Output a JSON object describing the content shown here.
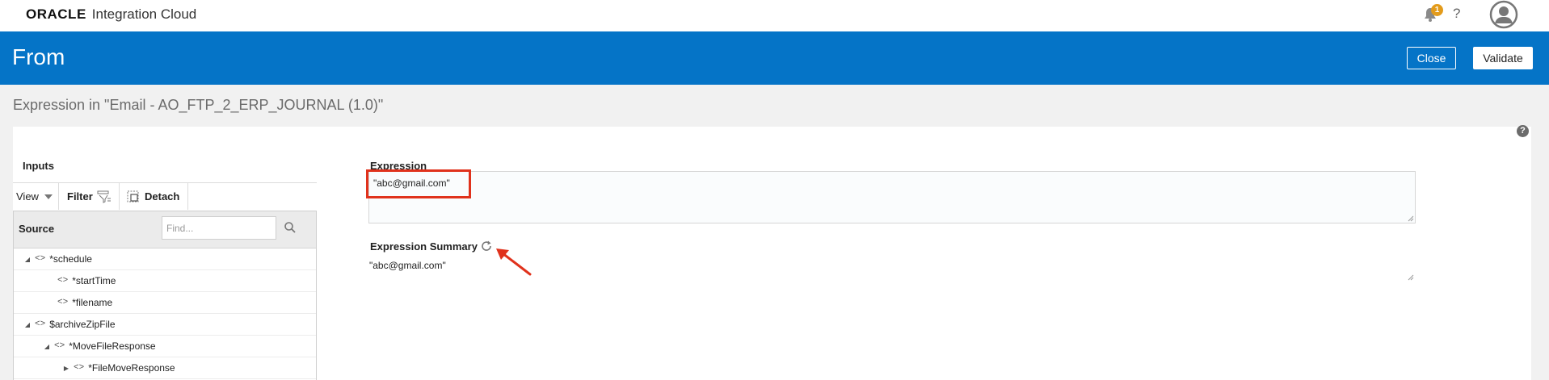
{
  "app": {
    "logo": "ORACLE",
    "name": "Integration Cloud",
    "notification_count": "1",
    "help_glyph": "?"
  },
  "header": {
    "title": "From",
    "close_label": "Close",
    "validate_label": "Validate",
    "bar_color": "#0574c7"
  },
  "page": {
    "title": "Expression in \"Email - AO_FTP_2_ERP_JOURNAL (1.0)\"",
    "help_glyph": "?"
  },
  "inputs": {
    "label": "Inputs",
    "toolbar": {
      "view_label": "View",
      "filter_label": "Filter",
      "detach_label": "Detach"
    },
    "source_label": "Source",
    "find_placeholder": "Find...",
    "tree": [
      {
        "name": "*schedule",
        "caret": "expanded",
        "level": 0
      },
      {
        "name": "*startTime",
        "caret": "none",
        "level": 1
      },
      {
        "name": "*filename",
        "caret": "none",
        "level": 1
      },
      {
        "name": "$archiveZipFile",
        "caret": "expanded",
        "level": 0
      },
      {
        "name": "*MoveFileResponse",
        "caret": "expanded",
        "level": 1
      },
      {
        "name": "*FileMoveResponse",
        "caret": "collapsed",
        "level": 2
      }
    ]
  },
  "expression": {
    "label": "Expression",
    "value": "\"abc@gmail.com\"",
    "summary_label": "Expression Summary",
    "summary_value": "\"abc@gmail.com\""
  },
  "annotations": {
    "highlight_color": "#e0321c"
  },
  "icons": {
    "bell": "bell-icon",
    "help": "help-icon",
    "avatar": "user-avatar-icon",
    "view_dropdown": "chevron-down-icon",
    "filter": "filter-icon",
    "detach": "detach-icon",
    "search": "search-icon",
    "refresh": "refresh-icon",
    "element_tag": "code-tag-icon"
  }
}
